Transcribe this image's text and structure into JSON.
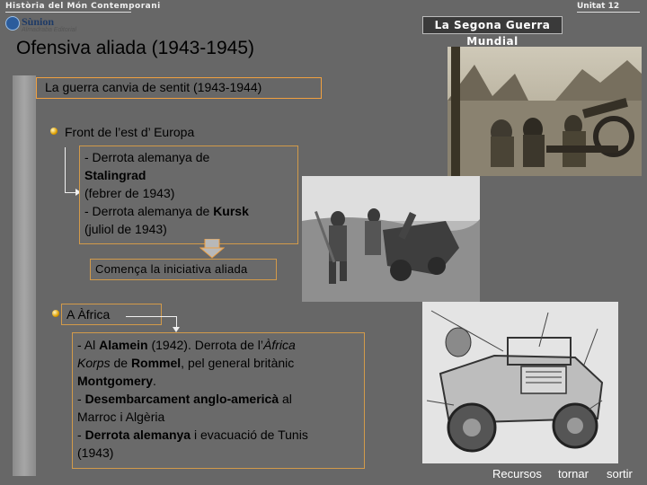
{
  "header": {
    "breadcrumb": "Història del Món Contemporani",
    "unit": "Unitat 12",
    "logo_name": "Sùnion",
    "logo_sub": "Almadraba Editorial",
    "section_title": "La Segona Guerra Mundial"
  },
  "page_title": "Ofensiva aliada (1943-1945)",
  "subtitle": "La guerra canvia de sentit (1943-1944)",
  "east_front": {
    "label": "Front de l’est d’ Europa",
    "line1_pre": "- Derrota alemanya de",
    "line2_bold": "Stalingrad",
    "line3": "(febrer de 1943)",
    "line4_pre": "- Derrota alemanya de ",
    "line4_bold": "Kursk",
    "line5": "(juliol de 1943)"
  },
  "initiative": "Comença la iniciativa aliada",
  "africa": {
    "label": "A Àfrica",
    "t1": "- Al ",
    "t1_bold": "Alamein",
    "t1_post": " (1942). Derrota de l’",
    "t1_italic": "Àfrica",
    "t2_italic": "Korps",
    "t2_mid": " de ",
    "t2_bold": "Rommel",
    "t2_post": ", pel general britànic",
    "t3_bold": "Montgomery",
    "t3_post": ".",
    "t4_pre": "- ",
    "t4_bold": "Desembarcament anglo-americà",
    "t4_post": " al",
    "t5": "Marroc i Algèria",
    "t6_pre": "- ",
    "t6_bold": "Derrota alemanya",
    "t6_post": " i evacuació de Tunis",
    "t7": "(1943)"
  },
  "footer": {
    "resources": "Recursos",
    "back": "tornar",
    "exit": "sortir"
  },
  "images": {
    "top_right": "soldiers-with-cannon-photo",
    "middle": "battlefield-wreckage-photo",
    "bottom_right": "military-jeep-illustration"
  }
}
